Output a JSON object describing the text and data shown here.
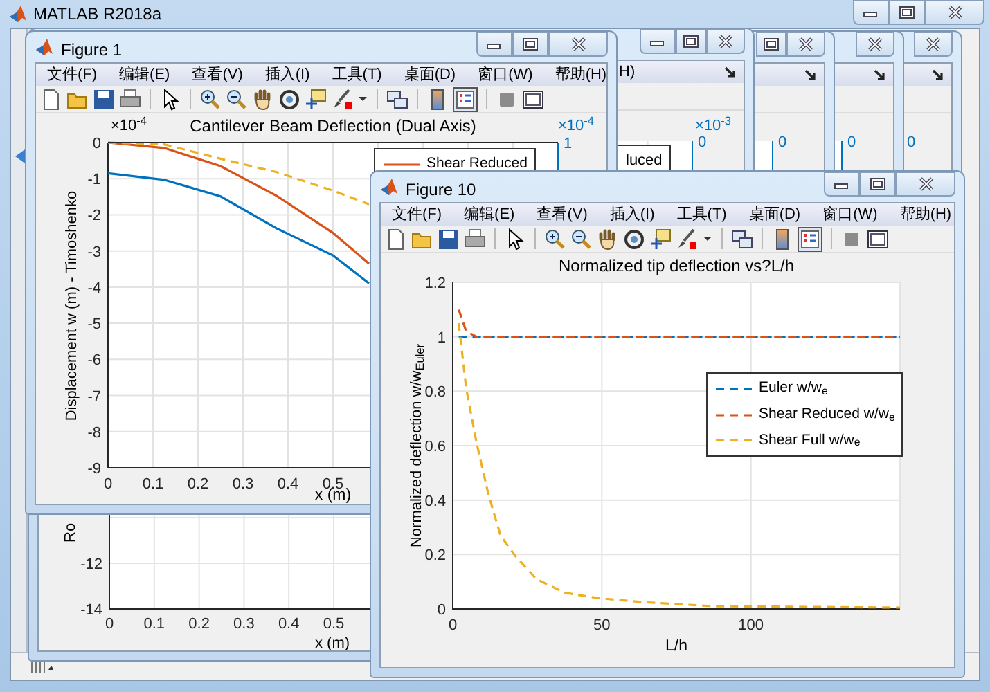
{
  "main_window": {
    "title": "MATLAB R2018a"
  },
  "background_windows": [
    {
      "title_buttons": [
        {
          "kind": "minimize"
        },
        {
          "kind": "restore"
        },
        {
          "kind": "close"
        }
      ],
      "menu_fragment": "H)",
      "right_axis": {
        "exponent": "×10$^{-3}$",
        "tick": "0"
      },
      "legend_fragment": "luced",
      "lower_axes": {
        "yticks": [
          "-12",
          "-14"
        ],
        "xticks": [
          "0",
          "0.1",
          "0.2",
          "0.3",
          "0.4",
          "0.5"
        ],
        "xlabel": "x (m)",
        "ylabel_fragment": "Ro"
      }
    },
    {
      "title_buttons": [
        {
          "kind": "restore"
        },
        {
          "kind": "close"
        }
      ],
      "right_axis": {
        "tick": "0"
      }
    },
    {
      "title_buttons": [
        {
          "kind": "close"
        }
      ],
      "right_axis": {
        "tick": "0"
      }
    },
    {
      "title_buttons": [
        {
          "kind": "close"
        }
      ],
      "right_axis": {
        "tick": "0"
      }
    }
  ],
  "figure_1": {
    "title": "Figure 1",
    "title_buttons": [
      {
        "kind": "minimize"
      },
      {
        "kind": "restore"
      },
      {
        "kind": "close"
      }
    ],
    "menu": [
      "文件(F)",
      "编辑(E)",
      "查看(V)",
      "插入(I)",
      "工具(T)",
      "桌面(D)",
      "窗口(W)",
      "帮助(H)"
    ],
    "left_axis_exponent": "×10$^{-4}$",
    "right_axis": {
      "exponent": "×10$^{-4}$",
      "tick": "1"
    },
    "chart_data": {
      "type": "line",
      "title": "Cantilever Beam Deflection (Dual Axis)",
      "xlabel": "x (m)",
      "ylabel": "Displacement w (m) - Timoshenko",
      "x": [
        0,
        0.125,
        0.25,
        0.375,
        0.5,
        0.58
      ],
      "series": [
        {
          "color": "#0072bd",
          "line_style": "solid",
          "values": [
            -0.85,
            -1.03,
            -1.49,
            -2.38,
            -3.12,
            -3.9
          ]
        },
        {
          "name": "Shear Reduced",
          "color": "#d95319",
          "line_style": "solid",
          "values": [
            0,
            -0.15,
            -0.65,
            -1.48,
            -2.5,
            -3.35
          ]
        },
        {
          "color": "#edb120",
          "line_style": "dashed",
          "values": [
            0,
            -0.05,
            -0.45,
            -0.82,
            -1.33,
            -1.71
          ]
        }
      ],
      "grid": true,
      "legend": true,
      "xlim": [
        0,
        1
      ],
      "ylim": [
        -9,
        0
      ],
      "xticks": [
        {
          "value": 0,
          "label": "0"
        },
        {
          "value": 0.1,
          "label": "0.1"
        },
        {
          "value": 0.2,
          "label": "0.2"
        },
        {
          "value": 0.3,
          "label": "0.3"
        },
        {
          "value": 0.4,
          "label": "0.4"
        },
        {
          "value": 0.5,
          "label": "0.5"
        }
      ],
      "yticks": [
        {
          "value": 0,
          "label": "0"
        },
        {
          "value": -1,
          "label": "-1"
        },
        {
          "value": -2,
          "label": "-2"
        },
        {
          "value": -3,
          "label": "-3"
        },
        {
          "value": -4,
          "label": "-4"
        },
        {
          "value": -5,
          "label": "-5"
        },
        {
          "value": -6,
          "label": "-6"
        },
        {
          "value": -7,
          "label": "-7"
        },
        {
          "value": -8,
          "label": "-8"
        },
        {
          "value": -9,
          "label": "-9"
        }
      ]
    }
  },
  "figure_10": {
    "title": "Figure 10",
    "title_buttons": [
      {
        "kind": "minimize"
      },
      {
        "kind": "restore"
      },
      {
        "kind": "close"
      }
    ],
    "menu": [
      "文件(F)",
      "编辑(E)",
      "查看(V)",
      "插入(I)",
      "工具(T)",
      "桌面(D)",
      "窗口(W)",
      "帮助(H)"
    ],
    "chart_data": {
      "type": "line",
      "title": "Normalized tip deflection vs?L/h",
      "xlabel": "L/h",
      "ylabel": "Normalized deflection w/w$_{Euler}$",
      "x": [
        2,
        4.5,
        8,
        12,
        16,
        21,
        28,
        37.5,
        48.5,
        64,
        87,
        150
      ],
      "series": [
        {
          "name": "Euler w/w$_{e}$",
          "color": "#0072bd",
          "line_style": "dashed",
          "values": [
            1,
            1,
            1,
            1,
            1,
            1,
            1,
            1,
            1,
            1,
            1,
            1
          ]
        },
        {
          "name": "Shear Reduced w/w$_{e}$",
          "color": "#d95319",
          "line_style": "dashed",
          "values": [
            1.1,
            1.02,
            1,
            1,
            1,
            1,
            1,
            1,
            1,
            1,
            1,
            1
          ]
        },
        {
          "name": "Shear Full w/w$_{e}$",
          "color": "#edb120",
          "line_style": "dashed",
          "values": [
            1.05,
            0.81,
            0.61,
            0.42,
            0.27,
            0.195,
            0.11,
            0.06,
            0.04,
            0.025,
            0.01,
            0.005
          ]
        }
      ],
      "grid": true,
      "legend": true,
      "xlim": [
        0,
        150
      ],
      "ylim": [
        0,
        1.2
      ],
      "xticks": [
        {
          "value": 0,
          "label": "0"
        },
        {
          "value": 50,
          "label": "50"
        },
        {
          "value": 100,
          "label": "100"
        }
      ],
      "yticks": [
        {
          "value": 0,
          "label": "0"
        },
        {
          "value": 0.2,
          "label": "0.2"
        },
        {
          "value": 0.4,
          "label": "0.4"
        },
        {
          "value": 0.6,
          "label": "0.6"
        },
        {
          "value": 0.8,
          "label": "0.8"
        },
        {
          "value": 1,
          "label": "1"
        },
        {
          "value": 1.2,
          "label": "1.2"
        }
      ]
    }
  }
}
